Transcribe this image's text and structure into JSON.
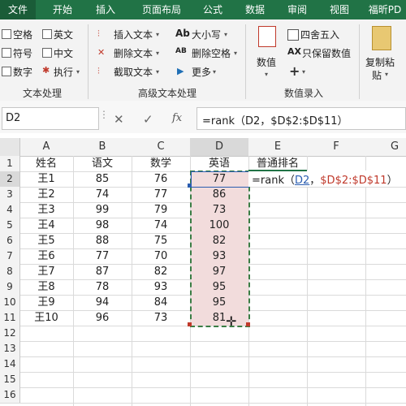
{
  "tabs": [
    "文件",
    "开始",
    "插入",
    "页面布局",
    "公式",
    "数据",
    "审阅",
    "视图",
    "福昕PD"
  ],
  "ribbon": {
    "checkboxes": [
      "空格",
      "英文",
      "符号",
      "中文",
      "数字"
    ],
    "exec_label": "执行",
    "group1_label": "文本处理",
    "text_tools": [
      "插入文本",
      "删除文本",
      "截取文本"
    ],
    "case_tool": "大小写",
    "remove_space": "删除空格",
    "more": "更多",
    "group2_label": "高级文本处理",
    "num_value": "数值",
    "round": "四舍五入",
    "keep_num": "只保留数值",
    "group3_label": "数值录入",
    "paste_line1": "复制粘",
    "paste_line2": "贴"
  },
  "formula_bar": {
    "name_box": "D2",
    "formula": "=rank（D2，$D$2:$D$11）"
  },
  "columns": [
    "A",
    "B",
    "C",
    "D",
    "E",
    "F",
    "G"
  ],
  "rows": [
    "1",
    "2",
    "3",
    "4",
    "5",
    "6",
    "7",
    "8",
    "9",
    "10",
    "11",
    "12",
    "13",
    "14",
    "15",
    "16"
  ],
  "header_row": [
    "姓名",
    "语文",
    "数学",
    "英语",
    "普通排名"
  ],
  "data_rows": [
    [
      "王1",
      "85",
      "76",
      "77"
    ],
    [
      "王2",
      "74",
      "77",
      "86"
    ],
    [
      "王3",
      "99",
      "79",
      "73"
    ],
    [
      "王4",
      "98",
      "74",
      "100"
    ],
    [
      "王5",
      "88",
      "75",
      "82"
    ],
    [
      "王6",
      "77",
      "70",
      "93"
    ],
    [
      "王7",
      "87",
      "82",
      "97"
    ],
    [
      "王8",
      "78",
      "93",
      "95"
    ],
    [
      "王9",
      "94",
      "84",
      "95"
    ],
    [
      "王10",
      "96",
      "73",
      "81"
    ]
  ],
  "edit_cell": {
    "part1": "=rank（",
    "part2": "D2",
    "part3": "，",
    "part4": "$D$2:$D$11",
    "part5": "）"
  }
}
